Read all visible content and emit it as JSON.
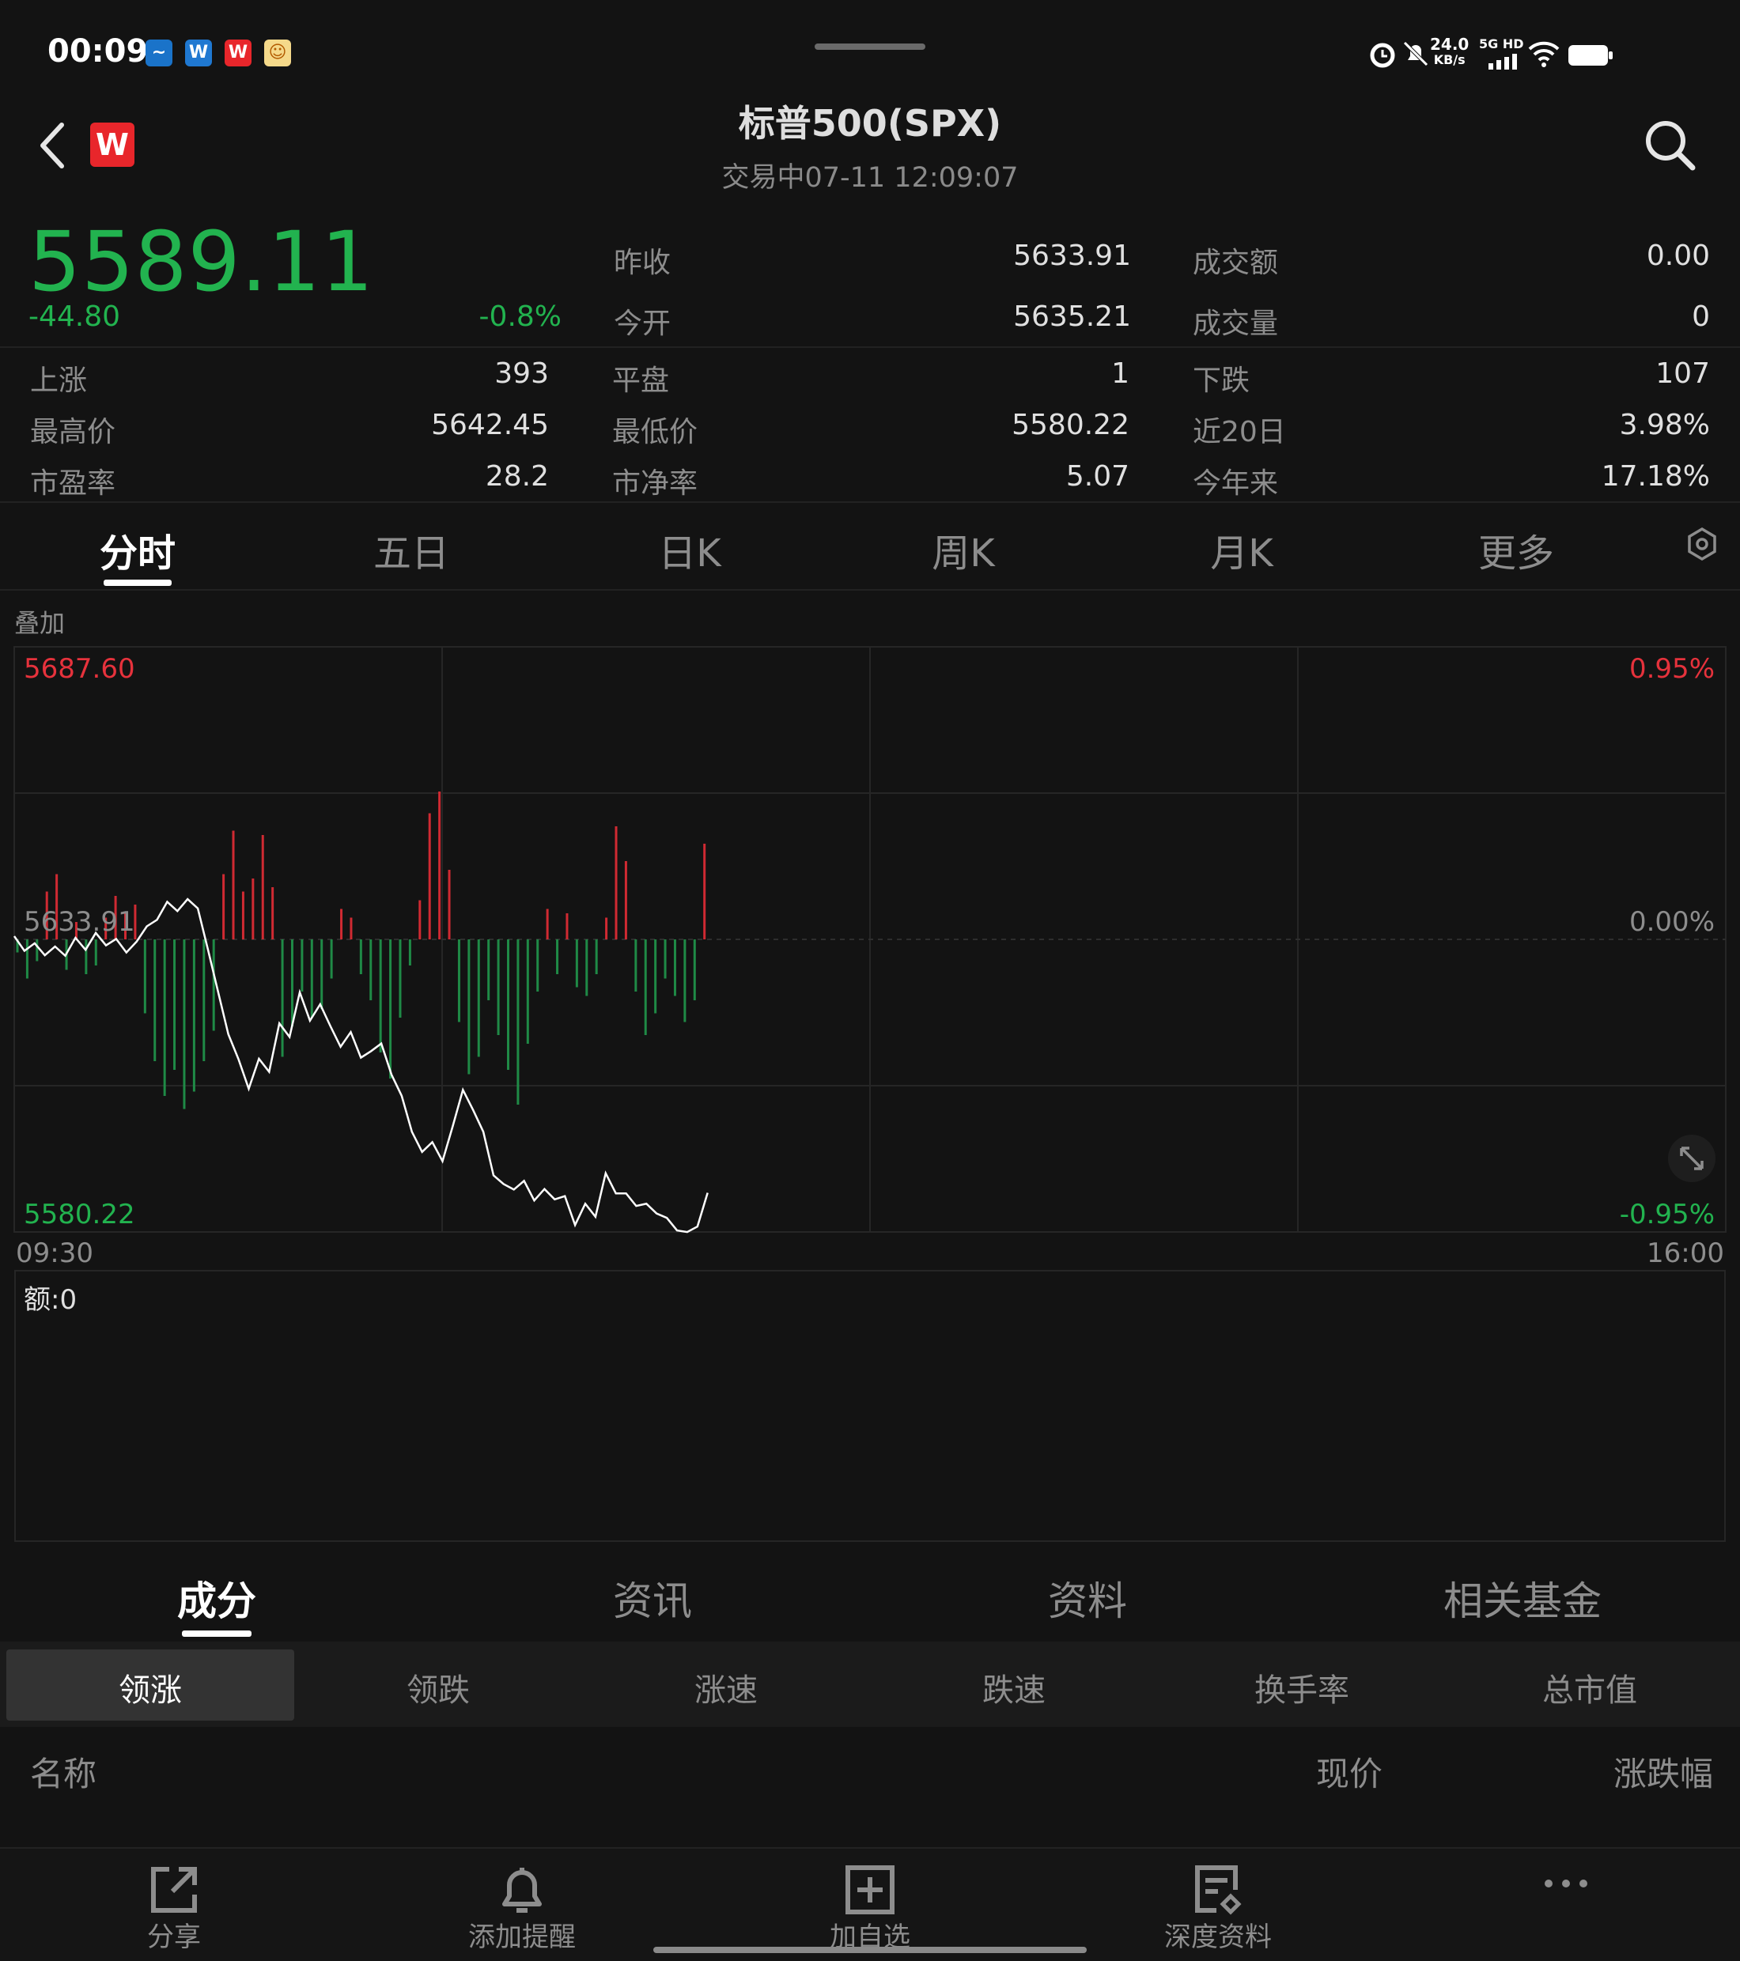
{
  "status_bar": {
    "time": "00:09",
    "net_speed_value": "24.0",
    "net_speed_unit": "KB/s",
    "network": "5G HD"
  },
  "header": {
    "title": "标普500(SPX)",
    "subtitle": "交易中07-11 12:09:07",
    "logo_letter": "W"
  },
  "quote": {
    "price": "5589.11",
    "change": "-44.80",
    "change_pct": "-0.8%",
    "fields": [
      {
        "label": "昨收",
        "value": "5633.91"
      },
      {
        "label": "成交额",
        "value": "0.00"
      },
      {
        "label": "今开",
        "value": "5635.21"
      },
      {
        "label": "成交量",
        "value": "0"
      },
      {
        "label": "上涨",
        "value": "393"
      },
      {
        "label": "平盘",
        "value": "1"
      },
      {
        "label": "下跌",
        "value": "107"
      },
      {
        "label": "最高价",
        "value": "5642.45"
      },
      {
        "label": "最低价",
        "value": "5580.22"
      },
      {
        "label": "近20日",
        "value": "3.98%"
      },
      {
        "label": "市盈率",
        "value": "28.2"
      },
      {
        "label": "市净率",
        "value": "5.07"
      },
      {
        "label": "今年来",
        "value": "17.18%"
      }
    ]
  },
  "period_tabs": [
    "分时",
    "五日",
    "日K",
    "周K",
    "月K",
    "更多"
  ],
  "chart": {
    "overlay_label": "叠加",
    "y_max": "5687.60",
    "y_mid": "5633.91",
    "y_min": "5580.22",
    "pct_max": "0.95%",
    "pct_mid": "0.00%",
    "pct_min": "-0.95%",
    "time_start": "09:30",
    "time_end": "16:00",
    "volume_label": "额:0"
  },
  "chart_data": {
    "type": "line",
    "ylim": [
      5580.22,
      5687.6
    ],
    "x_range": [
      "09:30",
      "16:00"
    ],
    "series": [
      {
        "values": [
          5634.5,
          5631.8,
          5633.2,
          5631.0,
          5632.6,
          5630.9,
          5634.2,
          5632.0,
          5635.1,
          5632.8,
          5634.0,
          5631.5,
          5633.5,
          5636.3,
          5637.5,
          5640.8,
          5639.1,
          5641.3,
          5639.6,
          5632.0,
          5624.2,
          5616.5,
          5611.9,
          5606.5,
          5612.0,
          5609.6,
          5618.5,
          5616.0,
          5624.2,
          5619.0,
          5622.0,
          5618.0,
          5614.2,
          5616.9,
          5612.2,
          5613.4,
          5614.8,
          5609.1,
          5605.2,
          5598.6,
          5594.9,
          5596.7,
          5593.2,
          5599.6,
          5606.3,
          5602.6,
          5598.6,
          5590.6,
          5589.0,
          5588.0,
          5589.6,
          5586.0,
          5588.1,
          5586.2,
          5586.8,
          5581.5,
          5585.4,
          5583.0,
          5591.0,
          5587.3,
          5587.3,
          5585.0,
          5585.4,
          5583.6,
          5582.8,
          5580.5,
          5580.2,
          5581.2,
          5587.4
        ]
      }
    ],
    "bars": [
      {
        "value": 3,
        "dir": "down"
      },
      {
        "value": 9,
        "dir": "down"
      },
      {
        "value": 5,
        "dir": "down"
      },
      {
        "value": 11,
        "dir": "up"
      },
      {
        "value": 15,
        "dir": "up"
      },
      {
        "value": 7,
        "dir": "down"
      },
      {
        "value": 4,
        "dir": "up"
      },
      {
        "value": 8,
        "dir": "down"
      },
      {
        "value": 6,
        "dir": "down"
      },
      {
        "value": 5,
        "dir": "up"
      },
      {
        "value": 10,
        "dir": "up"
      },
      {
        "value": 6,
        "dir": "up"
      },
      {
        "value": 8,
        "dir": "up"
      },
      {
        "value": 17,
        "dir": "down"
      },
      {
        "value": 28,
        "dir": "down"
      },
      {
        "value": 36,
        "dir": "down"
      },
      {
        "value": 30,
        "dir": "down"
      },
      {
        "value": 39,
        "dir": "down"
      },
      {
        "value": 35,
        "dir": "down"
      },
      {
        "value": 28,
        "dir": "down"
      },
      {
        "value": 21,
        "dir": "down"
      },
      {
        "value": 15,
        "dir": "up"
      },
      {
        "value": 25,
        "dir": "up"
      },
      {
        "value": 11,
        "dir": "up"
      },
      {
        "value": 14,
        "dir": "up"
      },
      {
        "value": 24,
        "dir": "up"
      },
      {
        "value": 12,
        "dir": "up"
      },
      {
        "value": 27,
        "dir": "down"
      },
      {
        "value": 20,
        "dir": "down"
      },
      {
        "value": 12,
        "dir": "down"
      },
      {
        "value": 18,
        "dir": "down"
      },
      {
        "value": 16,
        "dir": "down"
      },
      {
        "value": 9,
        "dir": "down"
      },
      {
        "value": 7,
        "dir": "up"
      },
      {
        "value": 5,
        "dir": "up"
      },
      {
        "value": 8,
        "dir": "down"
      },
      {
        "value": 14,
        "dir": "down"
      },
      {
        "value": 26,
        "dir": "down"
      },
      {
        "value": 32,
        "dir": "down"
      },
      {
        "value": 18,
        "dir": "down"
      },
      {
        "value": 6,
        "dir": "down"
      },
      {
        "value": 9,
        "dir": "up"
      },
      {
        "value": 29,
        "dir": "up"
      },
      {
        "value": 34,
        "dir": "up"
      },
      {
        "value": 16,
        "dir": "up"
      },
      {
        "value": 19,
        "dir": "down"
      },
      {
        "value": 31,
        "dir": "down"
      },
      {
        "value": 27,
        "dir": "down"
      },
      {
        "value": 14,
        "dir": "down"
      },
      {
        "value": 22,
        "dir": "down"
      },
      {
        "value": 30,
        "dir": "down"
      },
      {
        "value": 38,
        "dir": "down"
      },
      {
        "value": 24,
        "dir": "down"
      },
      {
        "value": 12,
        "dir": "down"
      },
      {
        "value": 7,
        "dir": "up"
      },
      {
        "value": 8,
        "dir": "down"
      },
      {
        "value": 6,
        "dir": "up"
      },
      {
        "value": 11,
        "dir": "down"
      },
      {
        "value": 13,
        "dir": "down"
      },
      {
        "value": 8,
        "dir": "down"
      },
      {
        "value": 5,
        "dir": "up"
      },
      {
        "value": 26,
        "dir": "up"
      },
      {
        "value": 18,
        "dir": "up"
      },
      {
        "value": 12,
        "dir": "down"
      },
      {
        "value": 22,
        "dir": "down"
      },
      {
        "value": 17,
        "dir": "down"
      },
      {
        "value": 9,
        "dir": "down"
      },
      {
        "value": 13,
        "dir": "down"
      },
      {
        "value": 19,
        "dir": "down"
      },
      {
        "value": 14,
        "dir": "down"
      },
      {
        "value": 22,
        "dir": "up"
      }
    ],
    "colors": {
      "price_line": "#ffffff",
      "bar_up": "#d02a32",
      "bar_down": "#1f8a46"
    }
  },
  "content_tabs": [
    "成分",
    "资讯",
    "资料",
    "相关基金"
  ],
  "sort_tabs": [
    "领涨",
    "领跌",
    "涨速",
    "跌速",
    "换手率",
    "总市值"
  ],
  "list_header": {
    "name": "名称",
    "price": "现价",
    "change": "涨跌幅"
  },
  "actions": [
    {
      "label": "分享",
      "icon": "share-icon"
    },
    {
      "label": "添加提醒",
      "icon": "bell-icon"
    },
    {
      "label": "加自选",
      "icon": "add-watchlist-icon"
    },
    {
      "label": "深度资料",
      "icon": "report-icon"
    },
    {
      "label": "",
      "icon": "more-icon"
    }
  ],
  "colors": {
    "up": "#e6323c",
    "down": "#22b34f",
    "background": "#131313"
  }
}
